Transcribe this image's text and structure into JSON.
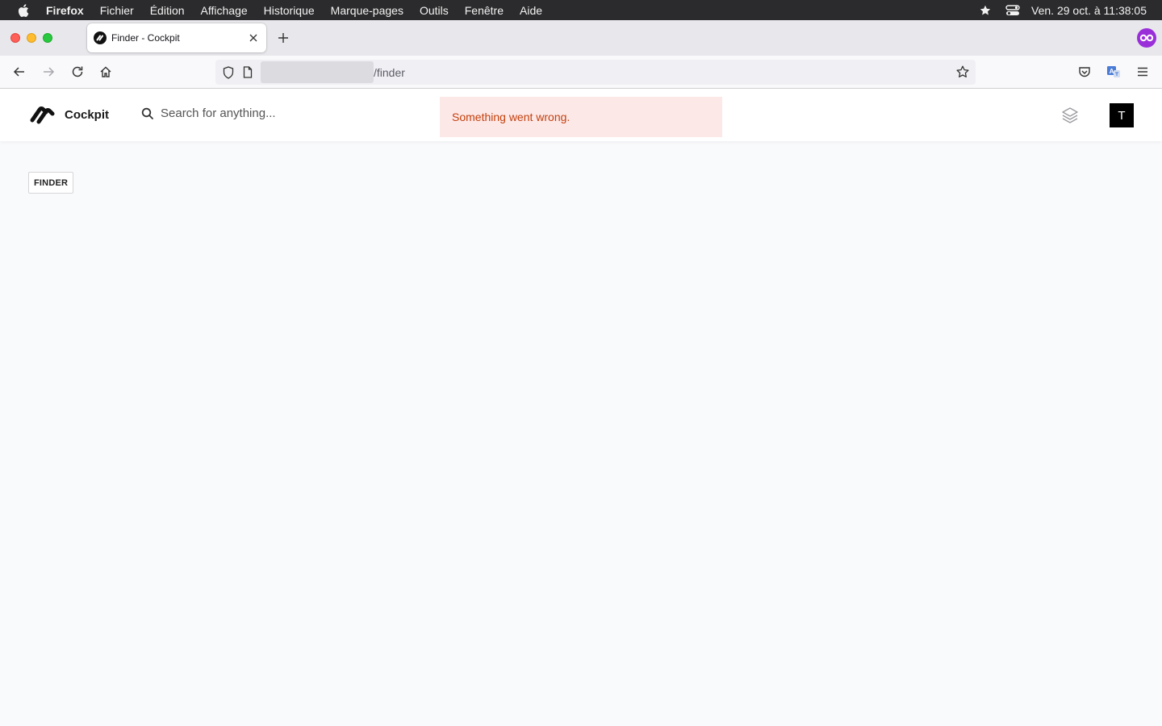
{
  "menubar": {
    "items": [
      "Firefox",
      "Fichier",
      "Édition",
      "Affichage",
      "Historique",
      "Marque-pages",
      "Outils",
      "Fenêtre",
      "Aide"
    ],
    "clock": "Ven. 29 oct. à  11:38:05",
    "icons": [
      "apple-icon",
      "star-icon",
      "control-center-icon"
    ]
  },
  "browser": {
    "tab_title": "Finder - Cockpit",
    "url_path": "/finder",
    "icons": [
      "back-icon",
      "forward-icon",
      "reload-icon",
      "home-icon",
      "shield-icon",
      "page-icon",
      "bookmark-star-icon",
      "pocket-icon",
      "translate-icon",
      "hamburger-menu-icon"
    ]
  },
  "app": {
    "brand": "Cockpit",
    "search_placeholder": "Search for anything...",
    "error_message": "Something went wrong.",
    "avatar_initial": "T",
    "page_badge": "FINDER"
  },
  "colors": {
    "menubar_bg": "#2b2b2d",
    "toast_bg": "#fde8e8",
    "toast_text": "#c2410c",
    "page_bg": "#f9fafc",
    "extension": "#9a2fd9"
  }
}
